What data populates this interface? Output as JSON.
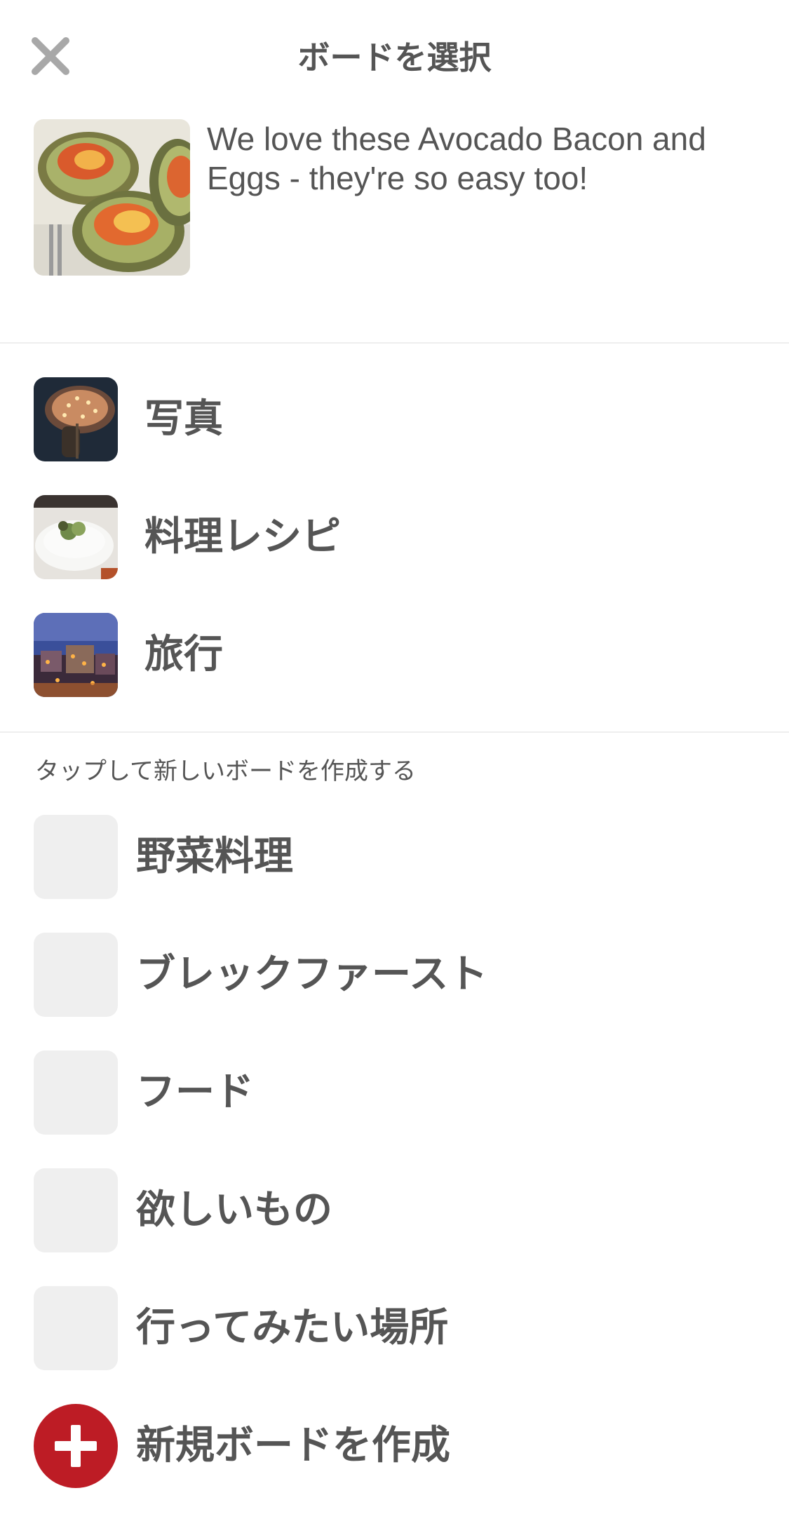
{
  "header": {
    "title": "ボードを選択",
    "close_icon": "close-icon"
  },
  "pin": {
    "description": "We love these Avocado Bacon and Eggs - they're so easy too!"
  },
  "recent_boards": [
    {
      "label": "写真"
    },
    {
      "label": "料理レシピ"
    },
    {
      "label": "旅行"
    }
  ],
  "suggestions": {
    "heading": "タップして新しいボードを作成する",
    "items": [
      {
        "label": "野菜料理"
      },
      {
        "label": "ブレックファースト"
      },
      {
        "label": "フード"
      },
      {
        "label": "欲しいもの"
      },
      {
        "label": "行ってみたい場所"
      }
    ]
  },
  "create": {
    "label": "新規ボードを作成",
    "icon": "plus-icon"
  },
  "colors": {
    "accent": "#bd1c25",
    "text": "#555555",
    "placeholder": "#efefef",
    "divider": "#eeeeee"
  }
}
